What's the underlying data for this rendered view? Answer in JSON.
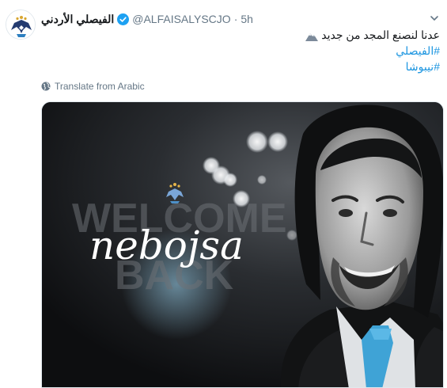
{
  "tweet": {
    "display_name": "الفيصلي الأردني",
    "handle": "@ALFAISALYSCJO",
    "separator": "·",
    "time": "5h",
    "text": "عدنا لنصنع المجد من جديد",
    "hashtags": [
      "#الفيصلي",
      "#نيبوشا"
    ],
    "translate_label": "Translate from Arabic",
    "media": {
      "welcome_text": "WELCOME",
      "back_text": "BACK",
      "name_text": "nebojsa"
    }
  },
  "icons": {
    "verified": "verified-badge-icon",
    "caret": "chevron-down-icon",
    "globe": "globe-icon",
    "text_emoji": "snow-capped-mountain-icon",
    "avatar": "eagle-crest-logo"
  },
  "colors": {
    "link": "#1b95e0",
    "verified": "#1da1f2",
    "muted": "#657786",
    "tie": "#3fa3d6"
  }
}
